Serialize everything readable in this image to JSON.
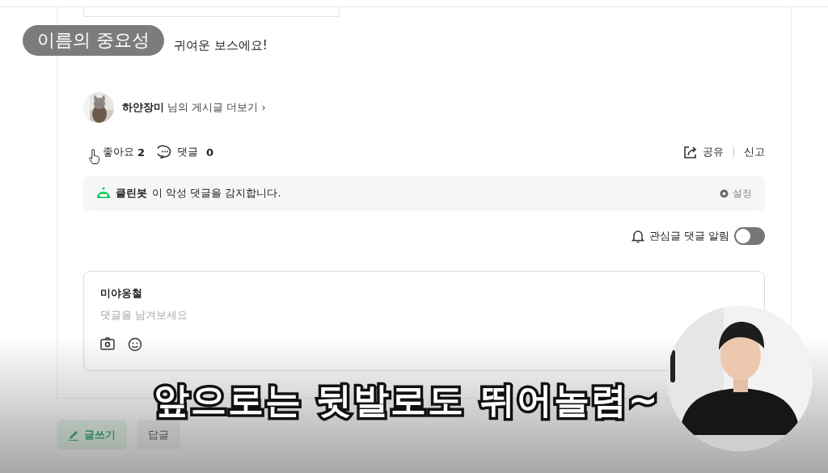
{
  "badge": "이름의 중요성",
  "post_text": "귀여운 보스에요!",
  "author": {
    "name": "하얀장미",
    "link": "님의 게시글 더보기 ›"
  },
  "reactions": {
    "like_label": "좋아요",
    "like_count": "2",
    "comment_label": "댓글",
    "comment_count": "0"
  },
  "actions": [
    "공유",
    "신고"
  ],
  "cleanbot": {
    "name": "클린봇",
    "message": "이 악성 댓글을 감지합니다.",
    "settings": "설정"
  },
  "notify": {
    "label": "관심글 댓글 알림",
    "on": false
  },
  "comment_box": {
    "user": "미야옹철",
    "placeholder": "댓글을 남겨보세요"
  },
  "buttons": [
    {
      "label": "글쓰기",
      "kind": "primary"
    },
    {
      "label": "답글",
      "kind": "secondary"
    }
  ],
  "subtitle": "앞으로는 뒷발로도 뛰어놀렴~"
}
